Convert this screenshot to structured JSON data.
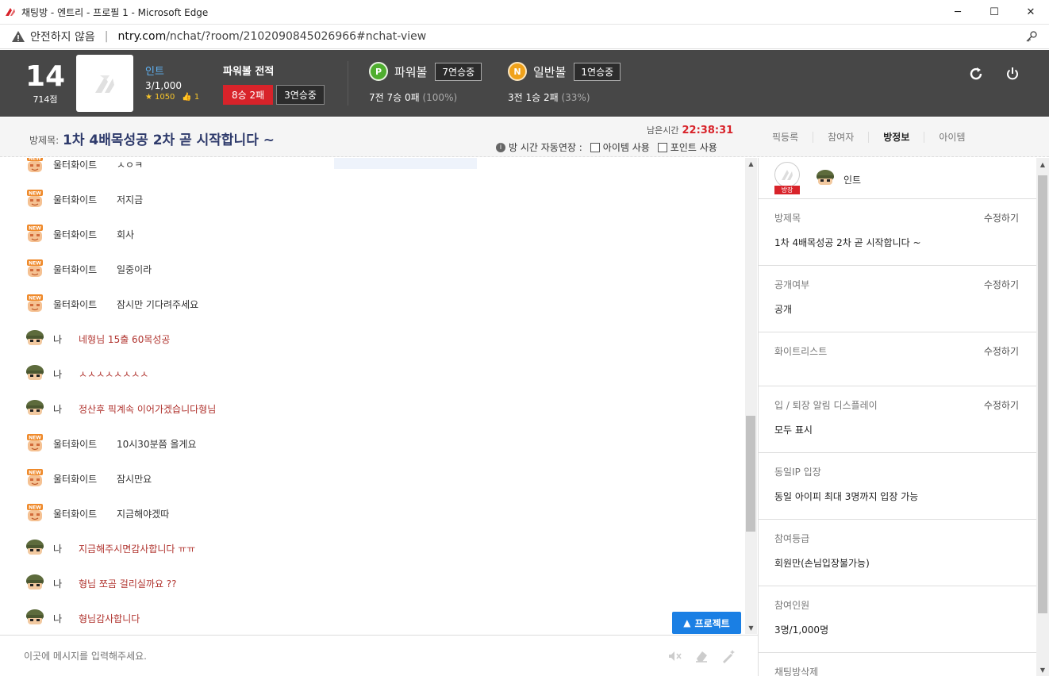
{
  "window": {
    "title": "채팅방 - 엔트리 - 프로필 1 - Microsoft Edge",
    "minimize": "─",
    "maximize": "☐",
    "close": "✕"
  },
  "address": {
    "insecure_label": "안전하지 않음",
    "separator": "|",
    "domain": "ntry.com",
    "path": "/nchat/?room/2102090845026966#nchat-view"
  },
  "profile": {
    "level": "14",
    "points": "714점",
    "name": "인트",
    "count": "3/1,000",
    "stars": "1050",
    "likes": "1"
  },
  "record": {
    "title": "파워볼 전적",
    "result": "8승 2패",
    "streak": "3연승중"
  },
  "powerball": {
    "coin": "P",
    "name": "파워볼",
    "streak": "7연승중",
    "stat": "7전 7승 0패",
    "pct": "(100%)",
    "color": "#4fae2f"
  },
  "normalball": {
    "coin": "N",
    "name": "일반볼",
    "streak": "1연승중",
    "stat": "3전 1승 2패",
    "pct": "(33%)",
    "color": "#f0a21a"
  },
  "room": {
    "label": "방제목:",
    "name": "1차 4배목성공 2차 곧 시작합니다 ~",
    "timer_label": "남은시간",
    "timer_value": "22:38:31",
    "auto_extend": "방 시간 자동연장 :",
    "opt_item": "아이템 사용",
    "opt_point": "포인트 사용"
  },
  "tabs": [
    "픽등록",
    "참여자",
    "방정보",
    "아이템"
  ],
  "messages": [
    {
      "nick": "울터화이트",
      "text": "ㅅㅇㅋ",
      "me": false
    },
    {
      "nick": "울터화이트",
      "text": "저지금",
      "me": false
    },
    {
      "nick": "울터화이트",
      "text": "회사",
      "me": false
    },
    {
      "nick": "울터화이트",
      "text": "일중이라",
      "me": false
    },
    {
      "nick": "울터화이트",
      "text": "잠시만 기다려주세요",
      "me": false
    },
    {
      "nick": "나",
      "text": "네형님 15출 60목성공",
      "me": true
    },
    {
      "nick": "나",
      "text": "ㅅㅅㅅㅅㅅㅅㅅㅅ",
      "me": true
    },
    {
      "nick": "나",
      "text": "정산후 픽계속 이어가겠습니다형님",
      "me": true
    },
    {
      "nick": "울터화이트",
      "text": "10시30분쯤 올게요",
      "me": false
    },
    {
      "nick": "울터화이트",
      "text": "잠시만요",
      "me": false
    },
    {
      "nick": "울터화이트",
      "text": "지금해야겠따",
      "me": false
    },
    {
      "nick": "나",
      "text": "지금해주시면감사합니다 ㅠㅠ",
      "me": true
    },
    {
      "nick": "나",
      "text": "형님 쪼곰 걸리실까요 ??",
      "me": true
    },
    {
      "nick": "나",
      "text": "형님감사합니다",
      "me": true
    }
  ],
  "project_button": "프로젝트",
  "input": {
    "placeholder": "이곳에 메시지를 입력해주세요."
  },
  "side": {
    "owner_tag": "방장",
    "owner_name": "인트",
    "edit_label": "수정하기",
    "sections": [
      {
        "label": "방제목",
        "value": "1차 4배목성공 2차 곧 시작합니다 ~",
        "edit": true
      },
      {
        "label": "공개여부",
        "value": "공개",
        "edit": true
      },
      {
        "label": "화이트리스트",
        "value": "",
        "edit": true
      },
      {
        "label": "입 / 퇴장 알림 디스플레이",
        "value": "모두 표시",
        "edit": true
      },
      {
        "label": "동일IP 입장",
        "value": "동일 아이피 최대 3명까지 입장 가능",
        "edit": false
      },
      {
        "label": "참여등급",
        "value": "회원만(손님입장불가능)",
        "edit": false
      },
      {
        "label": "참여인원",
        "value": "3명/1,000명",
        "edit": false
      },
      {
        "label": "채팅방삭제",
        "value": "",
        "edit": false
      }
    ]
  }
}
